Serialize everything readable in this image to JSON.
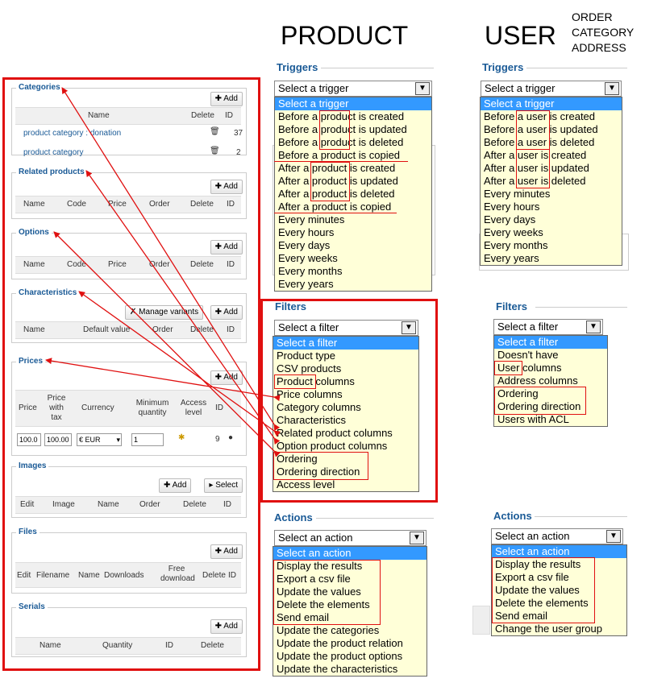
{
  "headings": {
    "product": "PRODUCT",
    "user": "USER",
    "order_note": [
      "ORDER",
      "CATEGORY",
      "ADDRESS"
    ]
  },
  "left": {
    "categories": {
      "title": "Categories",
      "add": "Add",
      "columns": [
        "Name",
        "Delete",
        "ID"
      ],
      "rows": [
        {
          "name": "product category : donation",
          "id": "37"
        },
        {
          "name": "product category",
          "id": "2"
        }
      ]
    },
    "related": {
      "title": "Related products",
      "add": "Add",
      "columns": [
        "Name",
        "Code",
        "Price",
        "Order",
        "Delete",
        "ID"
      ]
    },
    "options": {
      "title": "Options",
      "add": "Add",
      "columns": [
        "Name",
        "Code",
        "Price",
        "Order",
        "Delete",
        "ID"
      ]
    },
    "characteristics": {
      "title": "Characteristics",
      "manage": "Manage variants",
      "add": "Add",
      "columns": [
        "Name",
        "Default value",
        "Order",
        "Delete",
        "ID"
      ]
    },
    "prices": {
      "title": "Prices",
      "add": "Add",
      "columns": [
        "Price",
        "Price with tax",
        "Currency",
        "Minimum quantity",
        "Access level",
        "ID"
      ],
      "row": {
        "price": "100.0",
        "price_tax": "100.00",
        "currency": "€ EUR",
        "min_qty": "1",
        "id": "9"
      }
    },
    "images": {
      "title": "Images",
      "add": "Add",
      "select": "Select",
      "columns": [
        "Edit",
        "Image",
        "Name",
        "Order",
        "Delete",
        "ID"
      ]
    },
    "files": {
      "title": "Files",
      "add": "Add",
      "columns": [
        "Edit",
        "Filename",
        "Name",
        "Downloads",
        "Free download",
        "Delete",
        "ID"
      ]
    },
    "serials": {
      "title": "Serials",
      "add": "Add",
      "columns": [
        "Name",
        "Quantity",
        "ID",
        "Delete"
      ]
    }
  },
  "product": {
    "triggers": {
      "title": "Triggers",
      "selected": "Select a trigger",
      "options": [
        "Select a trigger",
        "Before a product is created",
        "Before a product is updated",
        "Before a product is deleted",
        "Before a product is copied",
        "After a product is created",
        "After a product is updated",
        "After a product is deleted",
        "After a product is copied",
        "Every minutes",
        "Every hours",
        "Every days",
        "Every weeks",
        "Every months",
        "Every years"
      ]
    },
    "filters": {
      "title": "Filters",
      "selected": "Select a filter",
      "options": [
        "Select a filter",
        "Product type",
        "CSV products",
        "Product columns",
        "Price columns",
        "Category columns",
        "Characteristics",
        "Related product columns",
        "Option product columns",
        "Ordering",
        "Ordering direction",
        "Access level"
      ]
    },
    "actions": {
      "title": "Actions",
      "selected": "Select an action",
      "options": [
        "Select an action",
        "Display the results",
        "Export a csv file",
        "Update the values",
        "Delete the elements",
        "Send email",
        "Update the categories",
        "Update the product relation",
        "Update the product options",
        "Update the characteristics"
      ]
    }
  },
  "user": {
    "triggers": {
      "title": "Triggers",
      "selected": "Select a trigger",
      "options": [
        "Select a trigger",
        "Before a user is created",
        "Before a user is updated",
        "Before a user is deleted",
        "After a user is created",
        "After a user is updated",
        "After a user is deleted",
        "Every minutes",
        "Every hours",
        "Every days",
        "Every weeks",
        "Every months",
        "Every years"
      ]
    },
    "filters": {
      "title": "Filters",
      "selected": "Select a filter",
      "options": [
        "Select a filter",
        "Doesn't have",
        "User columns",
        "Address columns",
        "Ordering",
        "Ordering direction",
        "Users with ACL"
      ]
    },
    "actions": {
      "title": "Actions",
      "selected": "Select an action",
      "options": [
        "Select an action",
        "Display the results",
        "Export a csv file",
        "Update the values",
        "Delete the elements",
        "Send email",
        "Change the user group"
      ]
    }
  },
  "colors": {
    "annotation": "#e01010",
    "legend": "#1a5a96",
    "dropdown_bg": "#ffffd8",
    "highlight": "#3399ff"
  }
}
